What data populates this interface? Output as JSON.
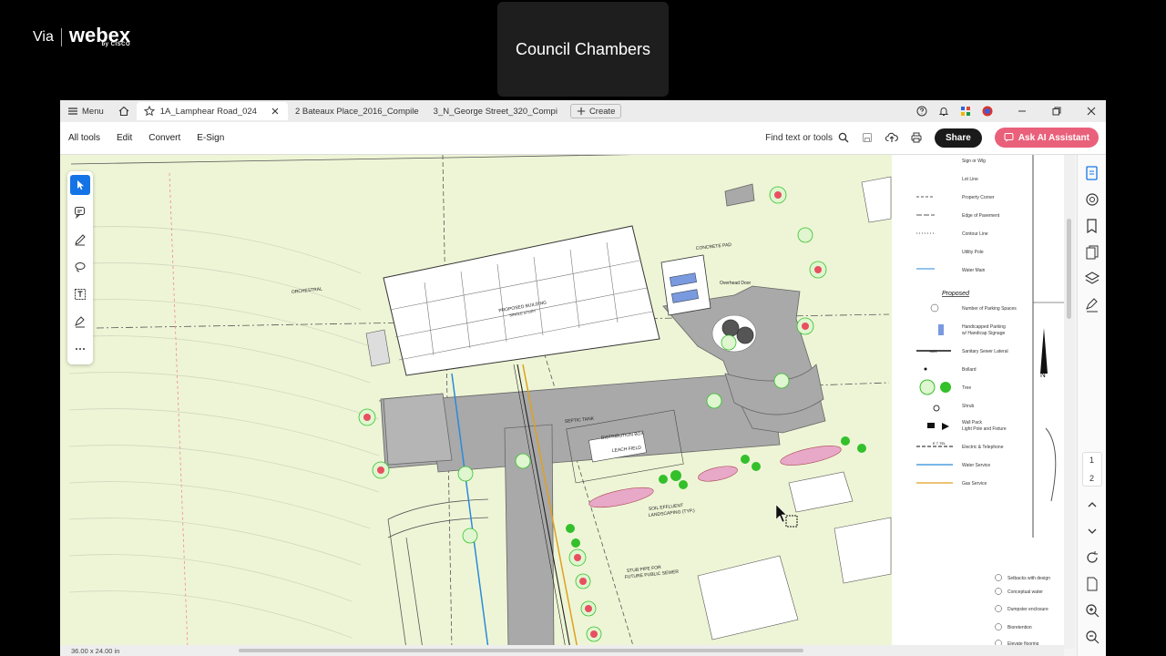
{
  "overlay": {
    "via": "Via",
    "brand": "webex",
    "brand_sub": "by CISCO",
    "room_name": "Council Chambers"
  },
  "tabs": {
    "menu_label": "Menu",
    "items": [
      {
        "label": "1A_Lamphear Road_024"
      },
      {
        "label": "2 Bateaux Place_2016_Compile"
      },
      {
        "label": "3_N_George Street_320_Compi"
      }
    ],
    "create_label": "Create"
  },
  "toolbar": {
    "items": [
      "All tools",
      "Edit",
      "Convert",
      "E-Sign"
    ],
    "find_label": "Find text or tools",
    "share_label": "Share",
    "ai_label": "Ask AI Assistant"
  },
  "page_nav": {
    "current": "1",
    "total": "2"
  },
  "status": {
    "dimensions": "36.00 x 24.00 in"
  },
  "plan": {
    "building_label": "PROPOSED BUILDING",
    "building_sub": "SINGLE STORY",
    "callouts": [
      "ORCHESTRAL",
      "CONCRETE PAD",
      "Overhead Door",
      "SEPTIC TANK",
      "DISTRIBUTION BOX",
      "LEACH FIELD",
      "SOIL EFFLUENT",
      "LANDSCAPING (TYP.)",
      "STUB PIPE FOR",
      "FUTURE PUBLIC SEWER"
    ],
    "legend_top": [
      "Sign or Wlg",
      "Lot Line",
      "Property Corner",
      "Edge of Pavement",
      "Contour Line",
      "Utility Pole",
      "Water Main"
    ],
    "legend_heading": "Proposed",
    "legend_proposed": [
      "Number of Parking Spaces",
      "Handicapped Parking",
      "w/ Handicap Signage",
      "Sanitary Sewer Lateral",
      "Bollard",
      "Tree",
      "Shrub",
      "Wall Pack",
      "Light Pole and Fixture",
      "Electric & Telephone",
      "Water Service",
      "Gas Service"
    ],
    "legend_sym": [
      "SAN",
      "E T TEL"
    ],
    "notes": [
      "Setbacks with design",
      "Conceptual water",
      "Dumpster enclosure",
      "Bioretention",
      "Elevate flooring"
    ],
    "north_label": "N"
  },
  "colors": {
    "ai_button": "#e9607a",
    "selected_tool": "#1473e6",
    "pavement": "#a9a9a9",
    "grass": "#eef5d6",
    "water_line": "#2a8ad8",
    "gas_line": "#e0a020",
    "tree_fill": "#dff6d0",
    "tree_red": "#e84f5f",
    "tree_green": "#33c02b"
  },
  "icons": [
    "menu-icon",
    "home-icon",
    "star-icon",
    "close-icon",
    "plus-icon",
    "help-icon",
    "bell-icon",
    "apps-icon",
    "avatar-icon",
    "minimize-icon",
    "restore-icon",
    "window-close-icon",
    "search-icon",
    "save-icon",
    "upload-icon",
    "print-icon",
    "ai-icon",
    "select-tool-icon",
    "comment-tool-icon",
    "pen-tool-icon",
    "lasso-tool-icon",
    "text-tool-icon",
    "stamp-tool-icon",
    "more-icon",
    "edit-panel-icon",
    "comment-panel-icon",
    "bookmark-icon",
    "pages-icon",
    "layers-icon",
    "sign-icon",
    "chevron-up-icon",
    "chevron-down-icon",
    "refresh-icon",
    "document-icon",
    "zoom-in-icon",
    "zoom-out-icon"
  ]
}
